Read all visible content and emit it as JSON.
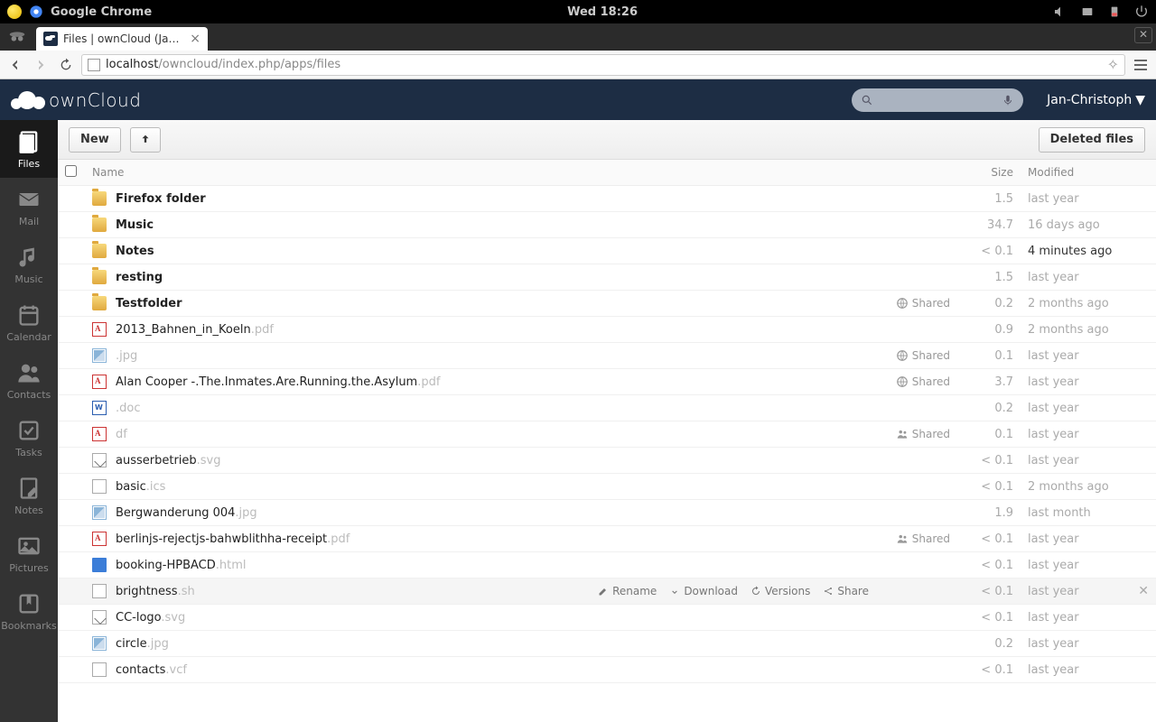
{
  "system": {
    "app_label": "Google Chrome",
    "clock": "Wed 18:26"
  },
  "browser": {
    "tab_title": "Files | ownCloud (Jan-Chri",
    "url_host": "localhost",
    "url_path": "/owncloud/index.php/apps/files"
  },
  "header": {
    "brand": "ownCloud",
    "username": "Jan-Christoph"
  },
  "nav": {
    "items": [
      {
        "label": "Files",
        "icon": "files",
        "active": true
      },
      {
        "label": "Mail",
        "icon": "mail",
        "active": false
      },
      {
        "label": "Music",
        "icon": "music",
        "active": false
      },
      {
        "label": "Calendar",
        "icon": "calendar",
        "active": false
      },
      {
        "label": "Contacts",
        "icon": "contacts",
        "active": false
      },
      {
        "label": "Tasks",
        "icon": "tasks",
        "active": false
      },
      {
        "label": "Notes",
        "icon": "notes",
        "active": false
      },
      {
        "label": "Pictures",
        "icon": "pictures",
        "active": false
      },
      {
        "label": "Bookmarks",
        "icon": "bookmarks",
        "active": false
      }
    ]
  },
  "controls": {
    "new_label": "New",
    "deleted_label": "Deleted files"
  },
  "columns": {
    "name": "Name",
    "size": "Size",
    "modified": "Modified"
  },
  "actions": {
    "rename": "Rename",
    "download": "Download",
    "versions": "Versions",
    "share": "Share",
    "shared_label": "Shared"
  },
  "files": [
    {
      "name": "Firefox folder",
      "ext": "",
      "icon": "folder",
      "bold": true,
      "shared": null,
      "size": "1.5",
      "modified": "last year",
      "recent": false
    },
    {
      "name": "Music",
      "ext": "",
      "icon": "folder",
      "bold": true,
      "shared": null,
      "size": "34.7",
      "modified": "16 days ago",
      "recent": false
    },
    {
      "name": "Notes",
      "ext": "",
      "icon": "folder",
      "bold": true,
      "shared": null,
      "size": "< 0.1",
      "modified": "4 minutes ago",
      "recent": true
    },
    {
      "name": "resting",
      "ext": "",
      "icon": "folder",
      "bold": true,
      "shared": null,
      "size": "1.5",
      "modified": "last year",
      "recent": false
    },
    {
      "name": "Testfolder",
      "ext": "",
      "icon": "folder",
      "bold": true,
      "shared": "link",
      "size": "0.2",
      "modified": "2 months ago",
      "recent": false
    },
    {
      "name": "2013_Bahnen_in_Koeln",
      "ext": ".pdf",
      "icon": "pdf",
      "bold": false,
      "shared": null,
      "size": "0.9",
      "modified": "2 months ago",
      "recent": false
    },
    {
      "name": "",
      "ext": ".jpg",
      "icon": "image",
      "bold": false,
      "shared": "link",
      "size": "0.1",
      "modified": "last year",
      "recent": false
    },
    {
      "name": "Alan Cooper -.The.Inmates.Are.Running.the.Asylum",
      "ext": ".pdf",
      "icon": "pdf",
      "bold": false,
      "shared": "link",
      "size": "3.7",
      "modified": "last year",
      "recent": false
    },
    {
      "name": "",
      "ext": ".doc",
      "icon": "doc",
      "bold": false,
      "shared": null,
      "size": "0.2",
      "modified": "last year",
      "recent": false
    },
    {
      "name": "",
      "ext": "df",
      "icon": "pdf",
      "bold": false,
      "shared": "user",
      "size": "0.1",
      "modified": "last year",
      "recent": false
    },
    {
      "name": "ausserbetrieb",
      "ext": ".svg",
      "icon": "svg",
      "bold": false,
      "shared": null,
      "size": "< 0.1",
      "modified": "last year",
      "recent": false
    },
    {
      "name": "basic",
      "ext": ".ics",
      "icon": "cal",
      "bold": false,
      "shared": null,
      "size": "< 0.1",
      "modified": "2 months ago",
      "recent": false
    },
    {
      "name": "Bergwanderung 004",
      "ext": ".jpg",
      "icon": "image",
      "bold": false,
      "shared": null,
      "size": "1.9",
      "modified": "last month",
      "recent": false
    },
    {
      "name": "berlinjs-rejectjs-bahwblithha-receipt",
      "ext": ".pdf",
      "icon": "pdf",
      "bold": false,
      "shared": "user",
      "size": "< 0.1",
      "modified": "last year",
      "recent": false
    },
    {
      "name": "booking-HPBACD",
      "ext": ".html",
      "icon": "html",
      "bold": false,
      "shared": null,
      "size": "< 0.1",
      "modified": "last year",
      "recent": false
    },
    {
      "name": "brightness",
      "ext": ".sh",
      "icon": "text",
      "bold": false,
      "shared": null,
      "size": "< 0.1",
      "modified": "last year",
      "recent": false,
      "hovered": true
    },
    {
      "name": "CC-logo",
      "ext": ".svg",
      "icon": "svg",
      "bold": false,
      "shared": null,
      "size": "< 0.1",
      "modified": "last year",
      "recent": false
    },
    {
      "name": "circle",
      "ext": ".jpg",
      "icon": "image",
      "bold": false,
      "shared": null,
      "size": "0.2",
      "modified": "last year",
      "recent": false
    },
    {
      "name": "contacts",
      "ext": ".vcf",
      "icon": "text",
      "bold": false,
      "shared": null,
      "size": "< 0.1",
      "modified": "last year",
      "recent": false
    }
  ]
}
